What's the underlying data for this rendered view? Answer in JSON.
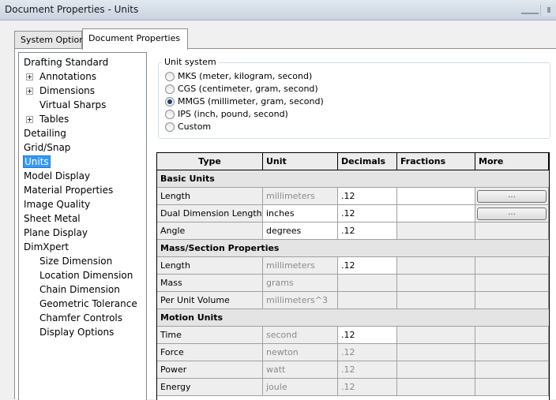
{
  "window": {
    "title": "Document Properties - Units"
  },
  "tabs": [
    {
      "label": "System Options"
    },
    {
      "label": "Document Properties"
    }
  ],
  "tree": [
    {
      "label": "Drafting Standard",
      "level": 0,
      "expandable": false,
      "selected": false
    },
    {
      "label": "Annotations",
      "level": 1,
      "expandable": true,
      "selected": false
    },
    {
      "label": "Dimensions",
      "level": 1,
      "expandable": true,
      "selected": false
    },
    {
      "label": "Virtual Sharps",
      "level": 1,
      "expandable": false,
      "selected": false
    },
    {
      "label": "Tables",
      "level": 1,
      "expandable": true,
      "selected": false
    },
    {
      "label": "Detailing",
      "level": 0,
      "expandable": false,
      "selected": false
    },
    {
      "label": "Grid/Snap",
      "level": 0,
      "expandable": false,
      "selected": false
    },
    {
      "label": "Units",
      "level": 0,
      "expandable": false,
      "selected": true
    },
    {
      "label": "Model Display",
      "level": 0,
      "expandable": false,
      "selected": false
    },
    {
      "label": "Material Properties",
      "level": 0,
      "expandable": false,
      "selected": false
    },
    {
      "label": "Image Quality",
      "level": 0,
      "expandable": false,
      "selected": false
    },
    {
      "label": "Sheet Metal",
      "level": 0,
      "expandable": false,
      "selected": false
    },
    {
      "label": "Plane Display",
      "level": 0,
      "expandable": false,
      "selected": false
    },
    {
      "label": "DimXpert",
      "level": 0,
      "expandable": false,
      "selected": false
    },
    {
      "label": "Size Dimension",
      "level": 1,
      "expandable": false,
      "selected": false
    },
    {
      "label": "Location Dimension",
      "level": 1,
      "expandable": false,
      "selected": false
    },
    {
      "label": "Chain Dimension",
      "level": 1,
      "expandable": false,
      "selected": false
    },
    {
      "label": "Geometric Tolerance",
      "level": 1,
      "expandable": false,
      "selected": false
    },
    {
      "label": "Chamfer Controls",
      "level": 1,
      "expandable": false,
      "selected": false
    },
    {
      "label": "Display Options",
      "level": 1,
      "expandable": false,
      "selected": false
    }
  ],
  "unit_system": {
    "legend": "Unit system",
    "options": [
      {
        "label": "MKS  (meter, kilogram, second)",
        "selected": false
      },
      {
        "label": "CGS  (centimeter, gram, second)",
        "selected": false
      },
      {
        "label": "MMGS (millimeter, gram, second)",
        "selected": true
      },
      {
        "label": "IPS  (inch, pound, second)",
        "selected": false
      },
      {
        "label": "Custom",
        "selected": false
      }
    ]
  },
  "table": {
    "headers": [
      "Type",
      "Unit",
      "Decimals",
      "Fractions",
      "More"
    ],
    "rows": [
      {
        "section": "Basic Units"
      },
      {
        "type": "Length",
        "unit": "millimeters",
        "decimals": ".12",
        "fractions": "",
        "more": "...",
        "unit_dim": true,
        "dec_dim": false,
        "frac_edit": true
      },
      {
        "type": "Dual Dimension Length",
        "unit": "inches",
        "decimals": ".12",
        "fractions": "",
        "more": "...",
        "unit_dim": false,
        "dec_dim": false,
        "frac_edit": true
      },
      {
        "type": "Angle",
        "unit": "degrees",
        "decimals": ".12",
        "fractions": "",
        "more": "",
        "unit_dim": false,
        "dec_dim": false,
        "frac_edit": false
      },
      {
        "section": "Mass/Section Properties"
      },
      {
        "type": "Length",
        "unit": "millimeters",
        "decimals": ".12",
        "fractions": "",
        "more": "",
        "unit_dim": true,
        "dec_dim": false,
        "frac_edit": false
      },
      {
        "type": "Mass",
        "unit": "grams",
        "decimals": "",
        "fractions": "",
        "more": "",
        "unit_dim": true,
        "dec_dim": true,
        "frac_edit": false
      },
      {
        "type": "Per Unit Volume",
        "unit": "millimeters^3",
        "decimals": "",
        "fractions": "",
        "more": "",
        "unit_dim": true,
        "dec_dim": true,
        "frac_edit": false
      },
      {
        "section": "Motion Units"
      },
      {
        "type": "Time",
        "unit": "second",
        "decimals": ".12",
        "fractions": "",
        "more": "",
        "unit_dim": true,
        "dec_dim": false,
        "frac_edit": false
      },
      {
        "type": "Force",
        "unit": "newton",
        "decimals": ".12",
        "fractions": "",
        "more": "",
        "unit_dim": true,
        "dec_dim": true,
        "frac_edit": false
      },
      {
        "type": "Power",
        "unit": "watt",
        "decimals": ".12",
        "fractions": "",
        "more": "",
        "unit_dim": true,
        "dec_dim": true,
        "frac_edit": false
      },
      {
        "type": "Energy",
        "unit": "joule",
        "decimals": ".12",
        "fractions": "",
        "more": "",
        "unit_dim": true,
        "dec_dim": true,
        "frac_edit": false
      }
    ]
  }
}
